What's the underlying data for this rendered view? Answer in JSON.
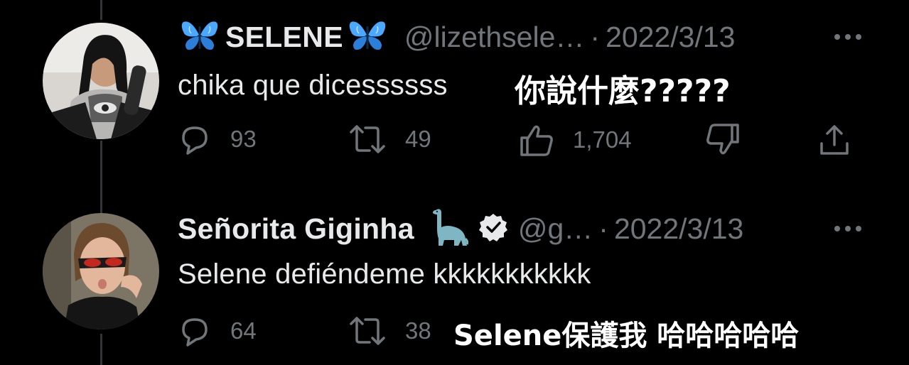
{
  "tweets": [
    {
      "display_name": "SELENE",
      "handle": "@lizethsele…",
      "separator": "·",
      "date": "2022/3/13",
      "text": "chika que dicessssss",
      "caption": "你說什麼?????",
      "replies": "93",
      "retweets": "49",
      "likes": "1,704",
      "name_emoji": "butterfly-icon",
      "butterfly_color": "#4aa8ff"
    },
    {
      "display_name": "Señorita Giginha",
      "handle": "@g…",
      "separator": "·",
      "date": "2022/3/13",
      "text": "Selene defiéndeme kkkkkkkkkkk",
      "caption": "Selene保護我 哈哈哈哈哈",
      "replies": "64",
      "retweets": "38",
      "name_emoji": "sauropod-icon",
      "verified": true
    }
  ],
  "colors": {
    "background": "#000000",
    "text_primary": "#e7e9ea",
    "text_secondary": "#71767b",
    "thread_line": "#333639"
  }
}
